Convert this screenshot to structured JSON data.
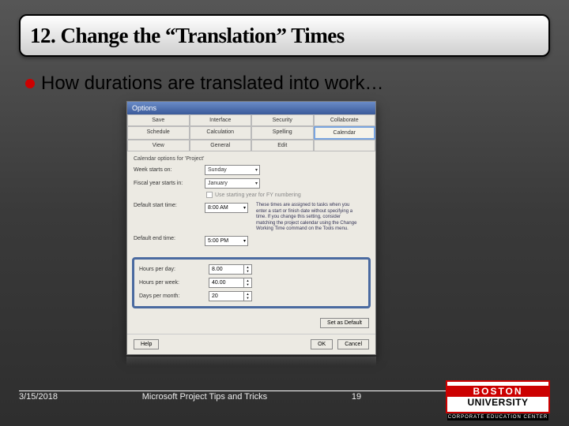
{
  "title": "12. Change the “Translation” Times",
  "bullet": "How durations are translated into work…",
  "dialog": {
    "title": "Options",
    "tabs": {
      "r1": [
        "Save",
        "Interface",
        "Security",
        "Collaborate"
      ],
      "r2": [
        "Schedule",
        "Calculation",
        "Spelling",
        "Calendar"
      ],
      "r3": [
        "View",
        "General",
        "Edit",
        ""
      ]
    },
    "section": "Calendar options for 'Project'",
    "week_starts": {
      "label": "Week starts on:",
      "value": "Sunday"
    },
    "fiscal_starts": {
      "label": "Fiscal year starts in:",
      "value": "January"
    },
    "fy_checkbox": "Use starting year for FY numbering",
    "default_start": {
      "label": "Default start time:",
      "value": "8:00 AM"
    },
    "default_end": {
      "label": "Default end time:",
      "value": "5:00 PM"
    },
    "note": "These times are assigned to tasks when you enter a start or finish date without specifying a time. If you change this setting, consider matching the project calendar using the Change Working Time command on the Tools menu.",
    "hours_per_day": {
      "label": "Hours per day:",
      "value": "8.00"
    },
    "hours_per_week": {
      "label": "Hours per week:",
      "value": "40.00"
    },
    "days_per_month": {
      "label": "Days per month:",
      "value": "20"
    },
    "set_default": "Set as Default",
    "help": "Help",
    "ok": "OK",
    "cancel": "Cancel"
  },
  "footer": {
    "date": "3/15/2018",
    "center": "Microsoft Project Tips and Tricks",
    "page": "19"
  },
  "logo": {
    "top": "BOSTON",
    "bottom": "UNIVERSITY",
    "sub": "CORPORATE EDUCATION CENTER"
  }
}
